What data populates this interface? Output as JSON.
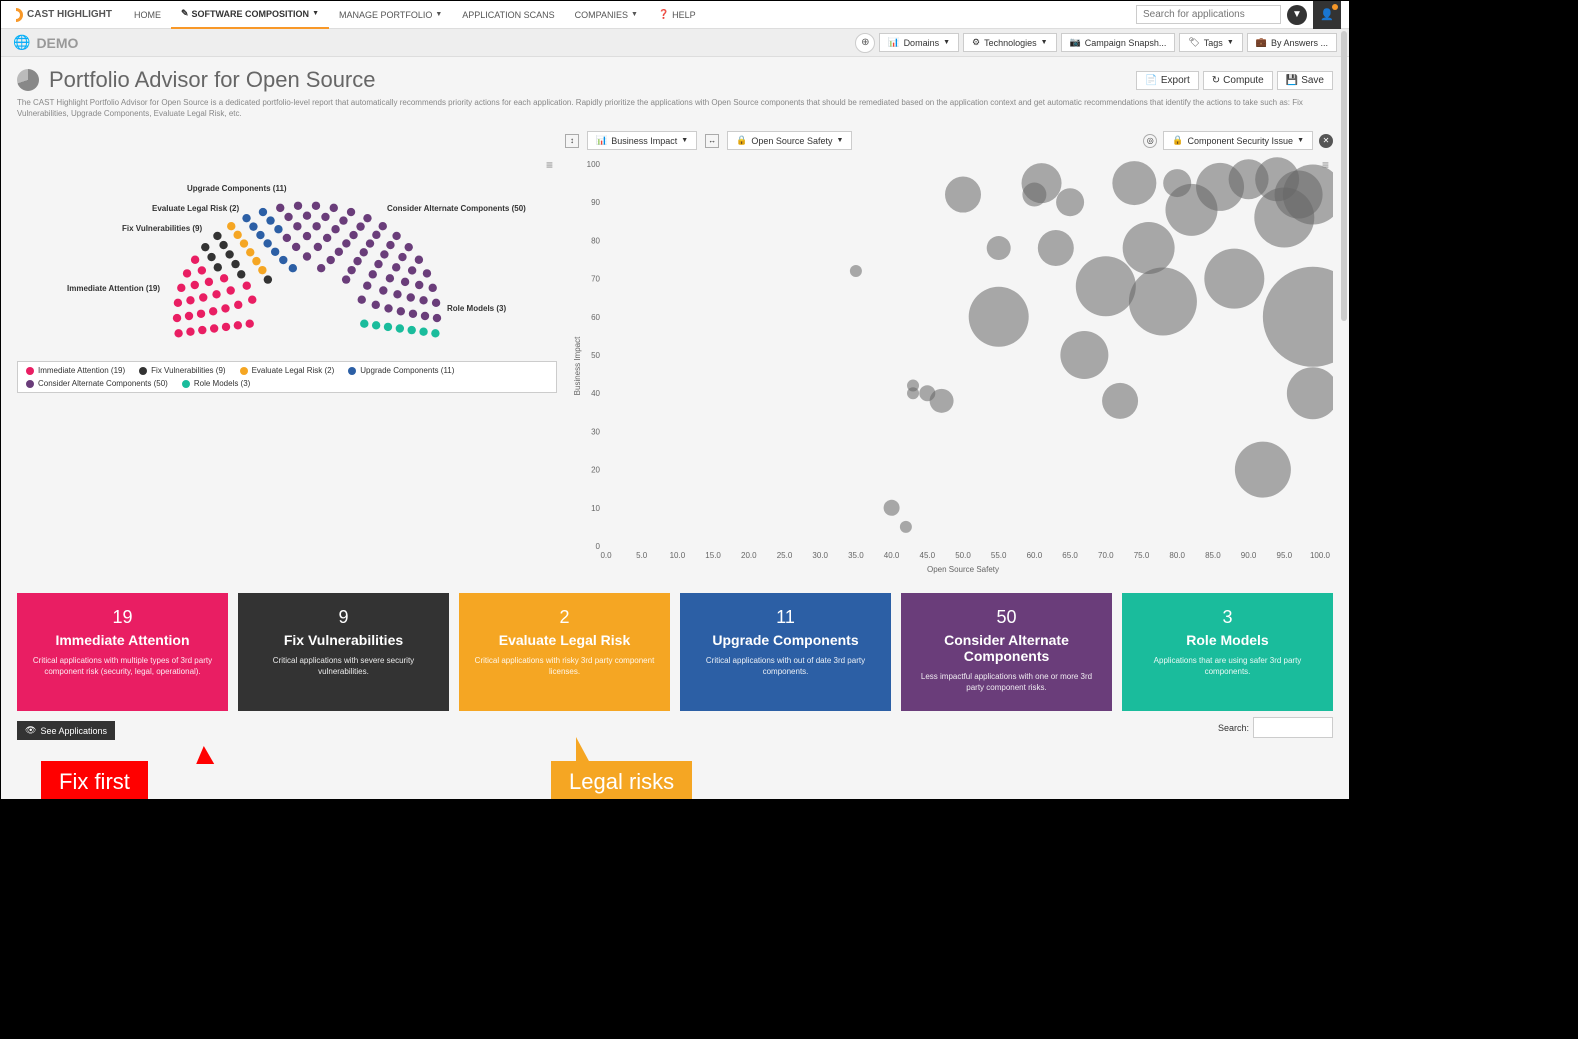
{
  "brand": "CAST HIGHLIGHT",
  "nav": {
    "home": "HOME",
    "software_composition": "SOFTWARE COMPOSITION",
    "manage_portfolio": "MANAGE PORTFOLIO",
    "application_scans": "APPLICATION SCANS",
    "companies": "COMPANIES",
    "help": "HELP"
  },
  "search_placeholder": "Search for applications",
  "demo_label": "DEMO",
  "filters": {
    "domains": "Domains",
    "technologies": "Technologies",
    "campaign": "Campaign Snapsh...",
    "tags": "Tags",
    "answers": "By Answers ..."
  },
  "page": {
    "title": "Portfolio Advisor for Open Source",
    "description": "The CAST Highlight Portfolio Advisor for Open Source is a dedicated portfolio-level report that automatically recommends priority actions for each application. Rapidly prioritize the applications with Open Source components that should be remediated based on the application context and get automatic recommendations that identify the actions to take such as: Fix Vulnerabilities, Upgrade Components, Evaluate Legal Risk, etc.",
    "export": "Export",
    "compute": "Compute",
    "save": "Save"
  },
  "axes": {
    "y_selector": "Business Impact",
    "x_selector": "Open Source Safety",
    "bubble_selector": "Component Security Issue"
  },
  "hemicycle": {
    "labels": {
      "immediate": "Immediate Attention (19)",
      "fix": "Fix Vulnerabilities (9)",
      "legal": "Evaluate Legal Risk (2)",
      "upgrade": "Upgrade Components (11)",
      "alternate": "Consider Alternate Components (50)",
      "rolemodels": "Role Models (3)"
    }
  },
  "legend": [
    {
      "color": "#e91e63",
      "label": "Immediate Attention (19)"
    },
    {
      "color": "#333333",
      "label": "Fix Vulnerabilities (9)"
    },
    {
      "color": "#f5a623",
      "label": "Evaluate Legal Risk (2)"
    },
    {
      "color": "#2c5fa5",
      "label": "Upgrade Components (11)"
    },
    {
      "color": "#6a3d7a",
      "label": "Consider Alternate Components (50)"
    },
    {
      "color": "#1abc9c",
      "label": "Role Models (3)"
    }
  ],
  "chart_data": {
    "type": "scatter",
    "xlabel": "Open Source Safety",
    "ylabel": "Business Impact",
    "xlim": [
      0,
      100
    ],
    "ylim": [
      0,
      100
    ],
    "x_ticks": [
      0.0,
      5.0,
      10.0,
      15.0,
      20.0,
      25.0,
      30.0,
      35.0,
      40.0,
      45.0,
      50.0,
      55.0,
      60.0,
      65.0,
      70.0,
      75.0,
      80.0,
      85.0,
      90.0,
      95.0,
      100.0
    ],
    "y_ticks": [
      0,
      10,
      20,
      30,
      40,
      50,
      60,
      70,
      80,
      90,
      100
    ],
    "bubbles": [
      {
        "x": 35,
        "y": 72,
        "r": 6
      },
      {
        "x": 42,
        "y": 5,
        "r": 6
      },
      {
        "x": 40,
        "y": 10,
        "r": 8
      },
      {
        "x": 43,
        "y": 40,
        "r": 6
      },
      {
        "x": 43,
        "y": 42,
        "r": 6
      },
      {
        "x": 45,
        "y": 40,
        "r": 8
      },
      {
        "x": 47,
        "y": 38,
        "r": 12
      },
      {
        "x": 50,
        "y": 92,
        "r": 18
      },
      {
        "x": 55,
        "y": 78,
        "r": 12
      },
      {
        "x": 55,
        "y": 60,
        "r": 30
      },
      {
        "x": 60,
        "y": 92,
        "r": 12
      },
      {
        "x": 61,
        "y": 95,
        "r": 20
      },
      {
        "x": 63,
        "y": 78,
        "r": 18
      },
      {
        "x": 65,
        "y": 90,
        "r": 14
      },
      {
        "x": 67,
        "y": 50,
        "r": 24
      },
      {
        "x": 70,
        "y": 68,
        "r": 30
      },
      {
        "x": 72,
        "y": 38,
        "r": 18
      },
      {
        "x": 74,
        "y": 95,
        "r": 22
      },
      {
        "x": 76,
        "y": 78,
        "r": 26
      },
      {
        "x": 78,
        "y": 64,
        "r": 34
      },
      {
        "x": 80,
        "y": 95,
        "r": 14
      },
      {
        "x": 82,
        "y": 88,
        "r": 26
      },
      {
        "x": 86,
        "y": 94,
        "r": 24
      },
      {
        "x": 88,
        "y": 70,
        "r": 30
      },
      {
        "x": 90,
        "y": 96,
        "r": 20
      },
      {
        "x": 92,
        "y": 20,
        "r": 28
      },
      {
        "x": 94,
        "y": 96,
        "r": 22
      },
      {
        "x": 95,
        "y": 86,
        "r": 30
      },
      {
        "x": 97,
        "y": 92,
        "r": 24
      },
      {
        "x": 99,
        "y": 60,
        "r": 50
      },
      {
        "x": 99,
        "y": 92,
        "r": 30
      },
      {
        "x": 99,
        "y": 40,
        "r": 26
      }
    ]
  },
  "cards": [
    {
      "count": "19",
      "title": "Immediate Attention",
      "desc": "Critical applications with multiple types of 3rd party component risk (security, legal, operational).",
      "cls": "c-pink"
    },
    {
      "count": "9",
      "title": "Fix Vulnerabilities",
      "desc": "Critical applications with severe security vulnerabilities.",
      "cls": "c-dark"
    },
    {
      "count": "2",
      "title": "Evaluate Legal Risk",
      "desc": "Critical applications with risky 3rd party component licenses.",
      "cls": "c-orange"
    },
    {
      "count": "11",
      "title": "Upgrade Components",
      "desc": "Critical applications with out of date 3rd party components.",
      "cls": "c-blue"
    },
    {
      "count": "50",
      "title": "Consider Alternate Components",
      "desc": "Less impactful applications with one or more 3rd party component risks.",
      "cls": "c-purple"
    },
    {
      "count": "3",
      "title": "Role Models",
      "desc": "Applications that are using safer 3rd party components.",
      "cls": "c-teal"
    }
  ],
  "see_apps": "See Applications",
  "search_footer": "Search:",
  "annotations": {
    "fix_first": "Fix first",
    "legal_risks": "Legal risks"
  },
  "hemi_segments": [
    {
      "color": "#e91e63",
      "count": 19
    },
    {
      "color": "#333333",
      "count": 9
    },
    {
      "color": "#f5a623",
      "count": 2
    },
    {
      "color": "#2c5fa5",
      "count": 11
    },
    {
      "color": "#6a3d7a",
      "count": 50
    },
    {
      "color": "#1abc9c",
      "count": 3
    }
  ]
}
